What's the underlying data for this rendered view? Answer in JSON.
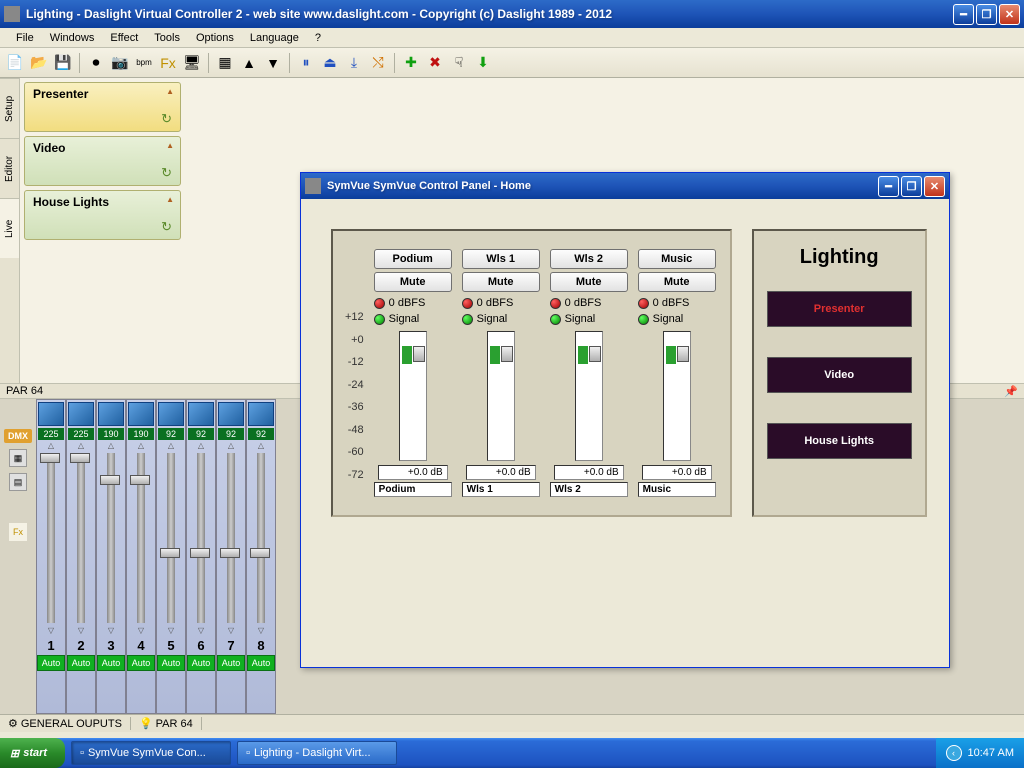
{
  "window": {
    "title": "Lighting - Daslight Virtual Controller 2  -  web site www.daslight.com  -  Copyright (c) Daslight 1989 - 2012"
  },
  "menu": [
    "File",
    "Windows",
    "Effect",
    "Tools",
    "Options",
    "Language",
    "?"
  ],
  "side_tabs": [
    "Setup",
    "Editor",
    "Live"
  ],
  "scenes": [
    {
      "name": "Presenter",
      "variant": "presenter"
    },
    {
      "name": "Video",
      "variant": "other"
    },
    {
      "name": "House Lights",
      "variant": "other"
    }
  ],
  "par_label": "PAR 64",
  "dmx_label": "DMX",
  "faders": [
    {
      "n": "1",
      "v": "225",
      "pos": 0
    },
    {
      "n": "2",
      "v": "225",
      "pos": 0
    },
    {
      "n": "3",
      "v": "190",
      "pos": 22
    },
    {
      "n": "4",
      "v": "190",
      "pos": 22
    },
    {
      "n": "5",
      "v": "92",
      "pos": 95
    },
    {
      "n": "6",
      "v": "92",
      "pos": 95
    },
    {
      "n": "7",
      "v": "92",
      "pos": 95
    },
    {
      "n": "8",
      "v": "92",
      "pos": 95
    }
  ],
  "fader_auto": "Auto",
  "bottom_tabs": [
    "GENERAL OUPUTS",
    "PAR 64"
  ],
  "symvue": {
    "title": "SymVue SymVue Control Panel - Home",
    "scale": [
      "+12",
      "+0",
      "-12",
      "-24",
      "-36",
      "-48",
      "-60",
      "-72"
    ],
    "mute_label": "Mute",
    "dbfs_label": "0 dBFS",
    "signal_label": "Signal",
    "channels": [
      {
        "btn": "Podium",
        "db": "+0.0 dB",
        "name": "Podium"
      },
      {
        "btn": "Wls 1",
        "db": "+0.0 dB",
        "name": "Wls 1"
      },
      {
        "btn": "Wls 2",
        "db": "+0.0 dB",
        "name": "Wls 2"
      },
      {
        "btn": "Music",
        "db": "+0.0 dB",
        "name": "Music"
      }
    ],
    "lighting": {
      "title": "Lighting",
      "buttons": [
        {
          "label": "Presenter",
          "cls": "red"
        },
        {
          "label": "Video",
          "cls": "wht"
        },
        {
          "label": "House Lights",
          "cls": "wht"
        }
      ]
    }
  },
  "taskbar": {
    "start": "start",
    "items": [
      "SymVue SymVue Con...",
      "Lighting - Daslight Virt..."
    ],
    "time": "10:47 AM"
  }
}
